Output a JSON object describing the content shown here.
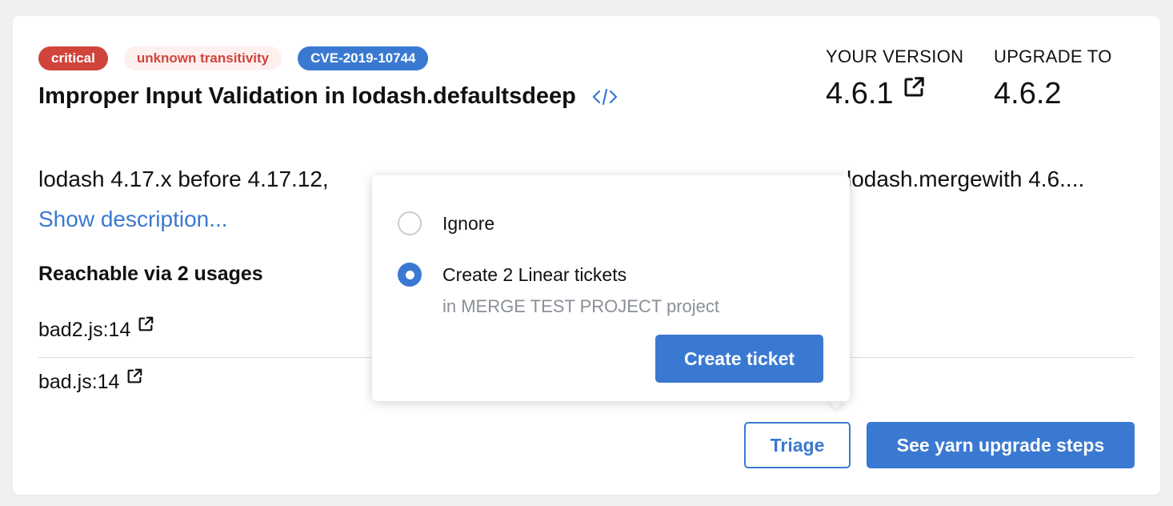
{
  "badges": {
    "severity": "critical",
    "transitivity": "unknown transitivity",
    "cve": "CVE-2019-10744"
  },
  "title": "Improper Input Validation in lodash.defaultsdeep",
  "version": {
    "current_label": "YOUR VERSION",
    "current_value": "4.6.1",
    "upgrade_label": "UPGRADE TO",
    "upgrade_value": "4.6.2"
  },
  "description": {
    "text_left": "lodash 4.17.x before 4.17.12,",
    "text_right": "lodash.mergewith 4.6....",
    "show_more": "Show description..."
  },
  "reachability": {
    "title": "Reachable via 2 usages",
    "usages": [
      {
        "location": "bad2.js:14"
      },
      {
        "location": "bad.js:14"
      }
    ]
  },
  "actions": {
    "triage": "Triage",
    "upgrade_steps": "See yarn upgrade steps"
  },
  "triage_popover": {
    "options": [
      {
        "label": "Ignore",
        "selected": false
      },
      {
        "label": "Create 2 Linear tickets",
        "sublabel": "in MERGE TEST PROJECT project",
        "selected": true
      }
    ],
    "submit": "Create ticket"
  },
  "colors": {
    "accent": "#3a79d1",
    "critical": "#d1443b",
    "critical_bg": "#fdf0ef"
  },
  "icons": {
    "code": "code-icon",
    "external": "external-link-icon"
  }
}
